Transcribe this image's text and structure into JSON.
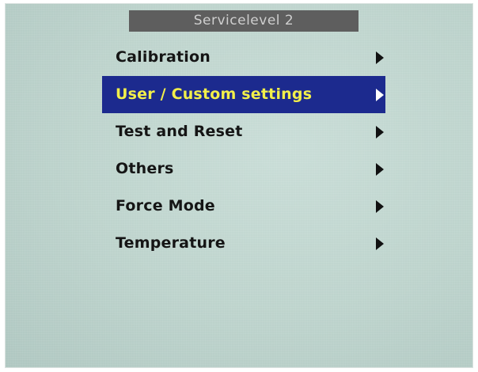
{
  "header": {
    "title": "Servicelevel 2"
  },
  "menu": {
    "items": [
      {
        "label": "Calibration",
        "arrow_icon": "triangle-right-icon"
      },
      {
        "label": "User / Custom settings",
        "arrow_icon": "triangle-right-icon",
        "selected": true
      },
      {
        "label": "Test and Reset",
        "arrow_icon": "triangle-right-icon"
      },
      {
        "label": "Others",
        "arrow_icon": "triangle-right-icon"
      },
      {
        "label": "Force Mode",
        "arrow_icon": "triangle-right-icon"
      },
      {
        "label": "Temperature",
        "arrow_icon": "triangle-right-icon"
      }
    ]
  },
  "colors": {
    "screen_background": "#bdd3cc",
    "title_background": "#5e5e5e",
    "title_text": "#cfcfcf",
    "selection_background": "#1c2a8e",
    "selection_text": "#f2ef4a",
    "menu_text": "#151515"
  }
}
